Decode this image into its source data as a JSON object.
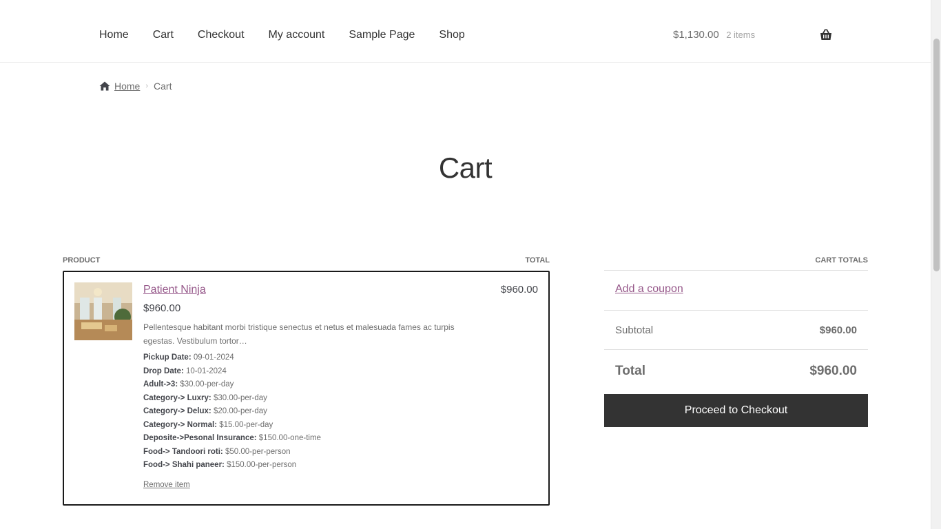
{
  "nav": {
    "items": [
      "Home",
      "Cart",
      "Checkout",
      "My account",
      "Sample Page",
      "Shop"
    ]
  },
  "header_cart": {
    "amount": "$1,130.00",
    "count": "2 items",
    "icon": "basket-icon"
  },
  "breadcrumb": {
    "home": "Home",
    "current": "Cart"
  },
  "page": {
    "title": "Cart"
  },
  "cart_table": {
    "col_product": "PRODUCT",
    "col_total": "TOTAL"
  },
  "item": {
    "title": "Patient Ninja",
    "price": "$960.00",
    "total": "$960.00",
    "description": "Pellentesque habitant morbi tristique senectus et netus et malesuada fames ac turpis egestas. Vestibulum tortor…",
    "meta": [
      {
        "label": "Pickup Date:",
        "value": "09-01-2024"
      },
      {
        "label": "Drop Date:",
        "value": "10-01-2024"
      },
      {
        "label": "Adult->3:",
        "value": "$30.00-per-day"
      },
      {
        "label": "Category-> Luxry:",
        "value": "$30.00-per-day"
      },
      {
        "label": "Category-> Delux:",
        "value": "$20.00-per-day"
      },
      {
        "label": "Category-> Normal:",
        "value": "$15.00-per-day"
      },
      {
        "label": "Deposite->Pesonal Insurance:",
        "value": "$150.00-one-time"
      },
      {
        "label": "Food-> Tandoori roti:",
        "value": "$50.00-per-person"
      },
      {
        "label": "Food-> Shahi paneer:",
        "value": "$150.00-per-person"
      }
    ],
    "remove_label": "Remove item"
  },
  "totals": {
    "heading": "CART TOTALS",
    "coupon_link": "Add a coupon",
    "subtotal_label": "Subtotal",
    "subtotal_value": "$960.00",
    "total_label": "Total",
    "total_value": "$960.00",
    "checkout_label": "Proceed to Checkout"
  },
  "colors": {
    "link": "#96588a",
    "button_bg": "#333333",
    "text": "#43454b"
  }
}
